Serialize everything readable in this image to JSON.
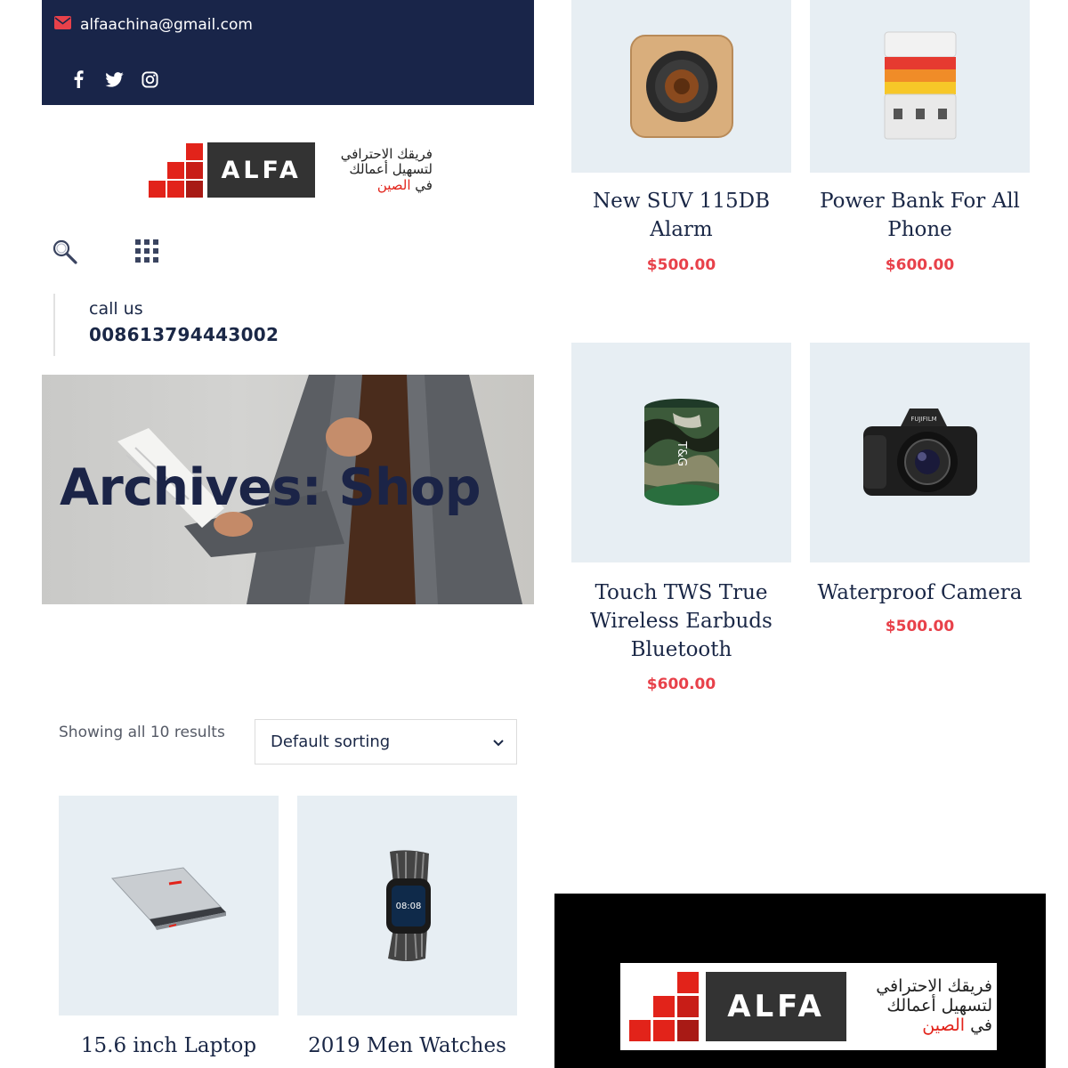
{
  "topbar": {
    "email": "alfaachina@gmail.com",
    "social_icons": [
      "facebook-icon",
      "twitter-icon",
      "instagram-icon"
    ]
  },
  "logo": {
    "wordmark": "ALFA",
    "arabic_line1": "فريقك الاحترافي",
    "arabic_line2": "لتسهيل أعمالك",
    "arabic_line3_a": "في",
    "arabic_line3_b": "الصين"
  },
  "contact": {
    "label": "call us",
    "phone": "008613794443002"
  },
  "hero": {
    "title": "Archives: Shop"
  },
  "shop": {
    "results_text": "Showing all 10 results",
    "sorting_selected": "Default sorting"
  },
  "products": [
    {
      "title_l1": "New SUV 115DB",
      "title_l2": "Alarm",
      "title_l3": "",
      "price": "$500.00",
      "image": "wooden-speaker"
    },
    {
      "title_l1": "Power Bank For All",
      "title_l2": "Phone",
      "title_l3": "",
      "price": "$600.00",
      "image": "power-bank"
    },
    {
      "title_l1": "Touch TWS True",
      "title_l2": "Wireless Earbuds",
      "title_l3": "Bluetooth",
      "price": "$600.00",
      "image": "camo-speaker",
      "brand_mark": "T&G"
    },
    {
      "title_l1": "Waterproof Camera",
      "title_l2": "",
      "title_l3": "",
      "price": "$500.00",
      "image": "dslr-camera",
      "brand_mark": "FUJIFILM"
    },
    {
      "title_l1": "15.6 inch Laptop",
      "title_l2": "",
      "title_l3": "",
      "price": "",
      "image": "laptop"
    },
    {
      "title_l1": "2019 Men Watches",
      "title_l2": "",
      "title_l3": "",
      "price": "",
      "image": "smart-watch",
      "screen_text": "08:08"
    }
  ],
  "colors": {
    "navy": "#192549",
    "price_red": "#e8414a",
    "card_bg": "#e7eef3",
    "logo_red": "#e2231a"
  }
}
